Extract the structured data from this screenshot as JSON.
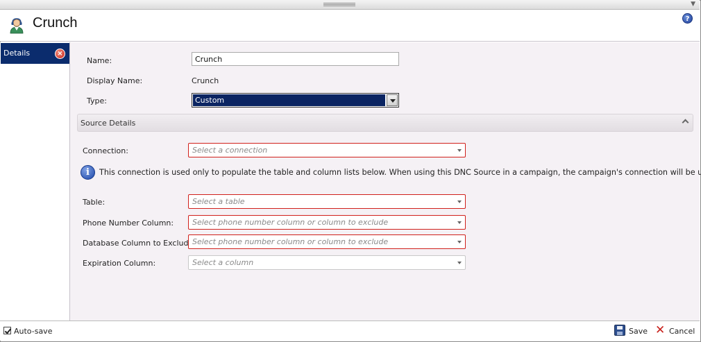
{
  "header": {
    "title": "Crunch",
    "app_icon": "user-headset-icon",
    "help_icon": "help-icon"
  },
  "nav": {
    "items": [
      {
        "label": "Details",
        "active": true,
        "close_icon": "close-icon"
      }
    ]
  },
  "form": {
    "name_label": "Name:",
    "name_value": "Crunch",
    "display_name_label": "Display Name:",
    "display_name_value": "Crunch",
    "type_label": "Type:",
    "type_value": "Custom"
  },
  "source_details": {
    "header": "Source Details",
    "connection_label": "Connection:",
    "connection_placeholder": "Select a connection",
    "info_text": "This connection is used only to populate the table and column lists below. When using this DNC Source in a campaign, the campaign's connection will be used.",
    "table_label": "Table:",
    "table_placeholder": "Select a table",
    "phone_label": "Phone Number Column:",
    "phone_placeholder": "Select phone number column or column to exclude",
    "exclude_label": "Database Column to Exclude:",
    "exclude_placeholder": "Select phone number column or column to exclude",
    "expiration_label": "Expiration Column:",
    "expiration_placeholder": "Select a column"
  },
  "footer": {
    "autosave_label": "Auto-save",
    "autosave_checked": true,
    "save_label": "Save",
    "cancel_label": "Cancel"
  },
  "colors": {
    "accent": "#0b2c6d",
    "error_border": "#d0201b",
    "panel_bg": "#f5f1f5"
  }
}
